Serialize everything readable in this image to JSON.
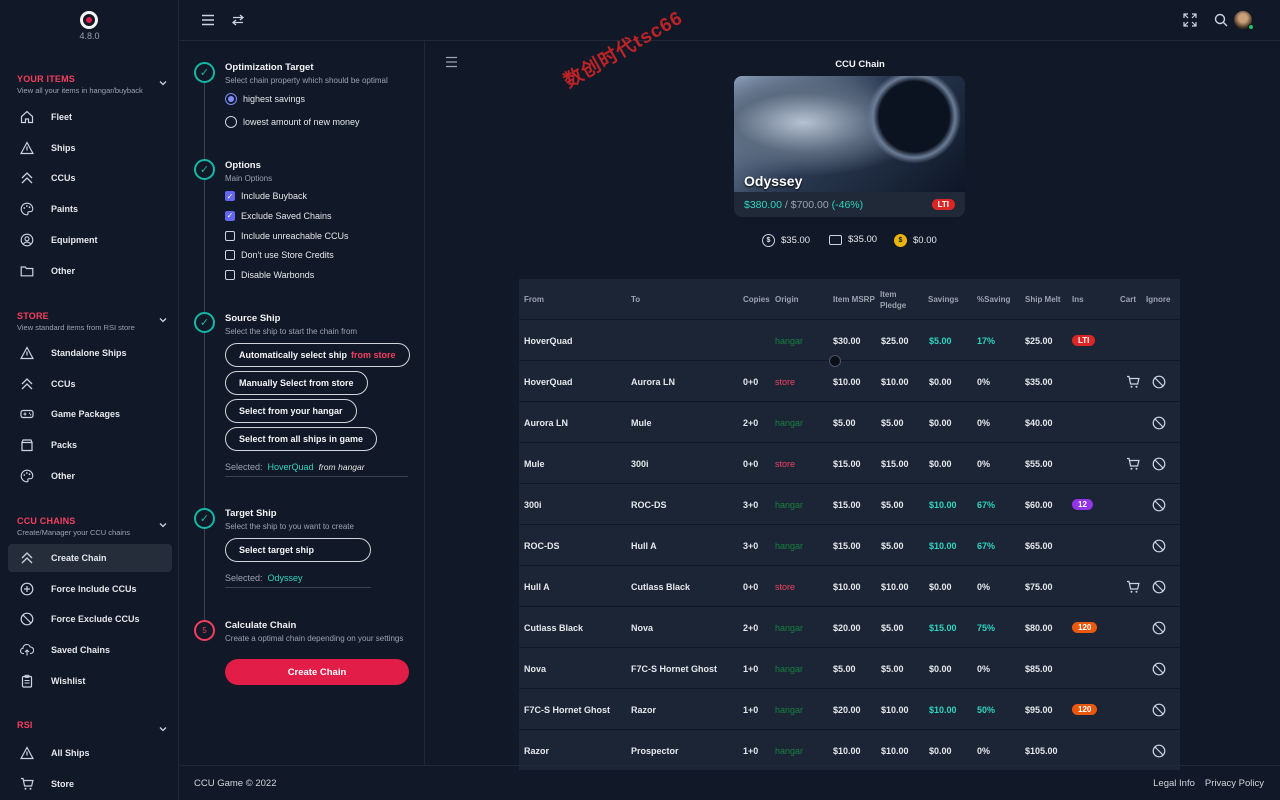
{
  "app": {
    "version": "4.8.0"
  },
  "sidebar": {
    "your_items": {
      "title": "YOUR ITEMS",
      "subtitle": "View all your items in hangar/buyback",
      "items": [
        {
          "label": "Fleet",
          "icon": "home-icon"
        },
        {
          "label": "Ships",
          "icon": "triangle-icon"
        },
        {
          "label": "CCUs",
          "icon": "chevrons-up-icon"
        },
        {
          "label": "Paints",
          "icon": "palette-icon"
        },
        {
          "label": "Equipment",
          "icon": "user-circle-icon"
        },
        {
          "label": "Other",
          "icon": "folder-icon"
        }
      ]
    },
    "store": {
      "title": "STORE",
      "subtitle": "View standard items from RSI store",
      "items": [
        {
          "label": "Standalone Ships",
          "icon": "triangle-icon"
        },
        {
          "label": "CCUs",
          "icon": "chevrons-up-icon"
        },
        {
          "label": "Game Packages",
          "icon": "gamepad-icon"
        },
        {
          "label": "Packs",
          "icon": "package-icon"
        },
        {
          "label": "Other",
          "icon": "palette-icon"
        }
      ]
    },
    "ccu_chains": {
      "title": "CCU CHAINS",
      "subtitle": "Create/Manager your CCU chains",
      "items": [
        {
          "label": "Create Chain",
          "icon": "chevrons-up-icon"
        },
        {
          "label": "Force Include CCUs",
          "icon": "plus-circle-icon"
        },
        {
          "label": "Force Exclude CCUs",
          "icon": "ban-icon"
        },
        {
          "label": "Saved Chains",
          "icon": "cloud-upload-icon"
        },
        {
          "label": "Wishlist",
          "icon": "clipboard-icon"
        }
      ]
    },
    "rsi": {
      "title": "RSI",
      "items": [
        {
          "label": "All Ships",
          "icon": "triangle-icon"
        },
        {
          "label": "Store",
          "icon": "cart-icon"
        }
      ]
    }
  },
  "options": {
    "optimization": {
      "title": "Optimization Target",
      "subtitle": "Select chain property which should be optimal",
      "options": [
        "highest savings",
        "lowest amount of new money"
      ]
    },
    "main_options": {
      "title": "Options",
      "subtitle": "Main Options",
      "checks": [
        {
          "label": "Include Buyback",
          "checked": true
        },
        {
          "label": "Exclude Saved Chains",
          "checked": true
        },
        {
          "label": "Include unreachable CCUs",
          "checked": false
        },
        {
          "label": "Don't use Store Credits",
          "checked": false
        },
        {
          "label": "Disable Warbonds",
          "checked": false
        }
      ]
    },
    "source": {
      "title": "Source Ship",
      "subtitle": "Select the ship to start the chain from",
      "btn_auto": "Automatically select ship",
      "btn_auto_suffix": "from store",
      "btn_manual": "Manually Select from store",
      "btn_hangar": "Select from your hangar",
      "btn_all": "Select from all ships in game",
      "selected_label": "Selected:",
      "selected_value": "HoverQuad",
      "selected_from": "from",
      "selected_origin": "hangar"
    },
    "target": {
      "title": "Target Ship",
      "subtitle": "Select the ship to you want to create",
      "btn": "Select target ship",
      "selected_label": "Selected:",
      "selected_value": "Odyssey"
    },
    "calculate": {
      "step": "5",
      "title": "Calculate Chain",
      "subtitle": "Create a optimal chain depending on your settings",
      "btn": "Create Chain"
    }
  },
  "chain": {
    "title": "CCU Chain",
    "ship_name": "Odyssey",
    "price_current": "$380.00",
    "price_sep": " / ",
    "price_original": "$700.00",
    "price_saving": "(-46%)",
    "insurance": "LTI",
    "totals": [
      {
        "icon": "dollar-icon",
        "value": "$35.00"
      },
      {
        "icon": "credit-card-icon",
        "value": "$35.00"
      },
      {
        "icon": "coin-icon",
        "value": "$0.00"
      }
    ]
  },
  "table": {
    "headers": {
      "from": "From",
      "to": "To",
      "copies": "Copies",
      "origin": "Origin",
      "msrp": "Item MSRP",
      "pledge": "Item Pledge",
      "savings": "Savings",
      "pct": "%Saving",
      "melt": "Ship Melt",
      "ins": "Ins",
      "cart": "Cart",
      "ignore": "Ignore"
    },
    "rows": [
      {
        "from": "HoverQuad",
        "to": "",
        "copies": "",
        "origin": "hangar",
        "msrp": "$30.00",
        "pledge": "$25.00",
        "savings": "$5.00",
        "pct": "17%",
        "melt": "$25.00",
        "ins": "LTI",
        "cart": false
      },
      {
        "from": "HoverQuad",
        "to": "Aurora LN",
        "copies": "0+0",
        "origin": "store",
        "msrp": "$10.00",
        "pledge": "$10.00",
        "savings": "$0.00",
        "pct": "0%",
        "melt": "$35.00",
        "ins": "",
        "cart": true
      },
      {
        "from": "Aurora LN",
        "to": "Mule",
        "copies": "2+0",
        "origin": "hangar",
        "msrp": "$5.00",
        "pledge": "$5.00",
        "savings": "$0.00",
        "pct": "0%",
        "melt": "$40.00",
        "ins": "",
        "cart": false
      },
      {
        "from": "Mule",
        "to": "300i",
        "copies": "0+0",
        "origin": "store",
        "msrp": "$15.00",
        "pledge": "$15.00",
        "savings": "$0.00",
        "pct": "0%",
        "melt": "$55.00",
        "ins": "",
        "cart": true
      },
      {
        "from": "300i",
        "to": "ROC-DS",
        "copies": "3+0",
        "origin": "hangar",
        "msrp": "$15.00",
        "pledge": "$5.00",
        "savings": "$10.00",
        "pct": "67%",
        "melt": "$60.00",
        "ins": "12",
        "cart": false
      },
      {
        "from": "ROC-DS",
        "to": "Hull A",
        "copies": "3+0",
        "origin": "hangar",
        "msrp": "$15.00",
        "pledge": "$5.00",
        "savings": "$10.00",
        "pct": "67%",
        "melt": "$65.00",
        "ins": "",
        "cart": false
      },
      {
        "from": "Hull A",
        "to": "Cutlass Black",
        "copies": "0+0",
        "origin": "store",
        "msrp": "$10.00",
        "pledge": "$10.00",
        "savings": "$0.00",
        "pct": "0%",
        "melt": "$75.00",
        "ins": "",
        "cart": true
      },
      {
        "from": "Cutlass Black",
        "to": "Nova",
        "copies": "2+0",
        "origin": "hangar",
        "msrp": "$20.00",
        "pledge": "$5.00",
        "savings": "$15.00",
        "pct": "75%",
        "melt": "$80.00",
        "ins": "120",
        "cart": false
      },
      {
        "from": "Nova",
        "to": "F7C-S Hornet Ghost",
        "copies": "1+0",
        "origin": "hangar",
        "msrp": "$5.00",
        "pledge": "$5.00",
        "savings": "$0.00",
        "pct": "0%",
        "melt": "$85.00",
        "ins": "",
        "cart": false
      },
      {
        "from": "F7C-S Hornet Ghost",
        "to": "Razor",
        "copies": "1+0",
        "origin": "hangar",
        "msrp": "$20.00",
        "pledge": "$10.00",
        "savings": "$10.00",
        "pct": "50%",
        "melt": "$95.00",
        "ins": "120",
        "cart": false
      },
      {
        "from": "Razor",
        "to": "Prospector",
        "copies": "1+0",
        "origin": "hangar",
        "msrp": "$10.00",
        "pledge": "$10.00",
        "savings": "$0.00",
        "pct": "0%",
        "melt": "$105.00",
        "ins": "",
        "cart": false
      }
    ]
  },
  "watermark": "数创时代tsc66",
  "footer": {
    "copyright": "CCU Game © 2022",
    "legal": "Legal Info",
    "privacy": "Privacy Policy"
  }
}
